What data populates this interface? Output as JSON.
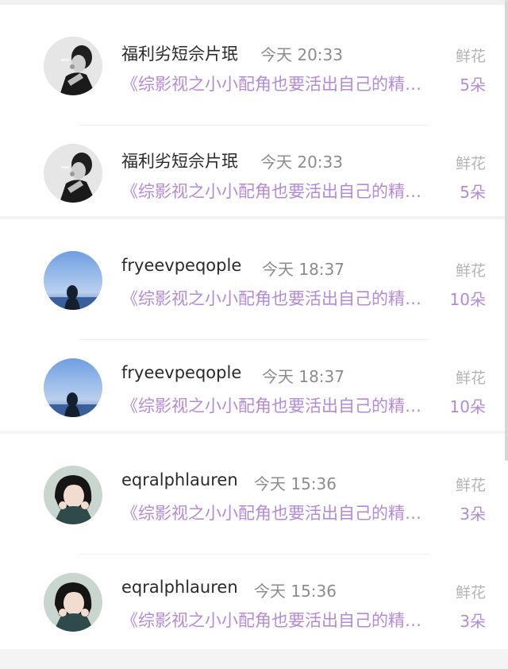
{
  "records": [
    {
      "user": "福利劣短佘片珉",
      "time": "今天 20:33",
      "gift": "鲜花",
      "book": "《综影视之小小配角也要活出自己的精彩》",
      "count": "5朵",
      "avatar": "avatar-smoking-man"
    },
    {
      "user": "福利劣短佘片珉",
      "time": "今天 20:33",
      "gift": "鲜花",
      "book": "《综影视之小小配角也要活出自己的精彩》",
      "count": "5朵",
      "avatar": "avatar-smoking-man"
    },
    {
      "user": "fryeevpeqople",
      "time": "今天 18:37",
      "gift": "鲜花",
      "book": "《综影视之小小配角也要活出自己的精彩》",
      "count": "10朵",
      "avatar": "avatar-sky-silhouette"
    },
    {
      "user": "fryeevpeqople",
      "time": "今天 18:37",
      "gift": "鲜花",
      "book": "《综影视之小小配角也要活出自己的精彩》",
      "count": "10朵",
      "avatar": "avatar-sky-silhouette"
    },
    {
      "user": "eqralphlauren",
      "time": "今天 15:36",
      "gift": "鲜花",
      "book": "《综影视之小小配角也要活出自己的精彩》",
      "count": "3朵",
      "avatar": "avatar-anime-girl"
    },
    {
      "user": "eqralphlauren",
      "time": "今天 15:36",
      "gift": "鲜花",
      "book": "《综影视之小小配角也要活出自己的精彩》",
      "count": "3朵",
      "avatar": "avatar-anime-girl"
    }
  ],
  "colors": {
    "accent": "#b48ad8",
    "name": "#2a2a2a",
    "meta": "#8c8c8c",
    "gift": "#b4b4b4",
    "background": "#f4f4f4",
    "card": "#ffffff"
  }
}
